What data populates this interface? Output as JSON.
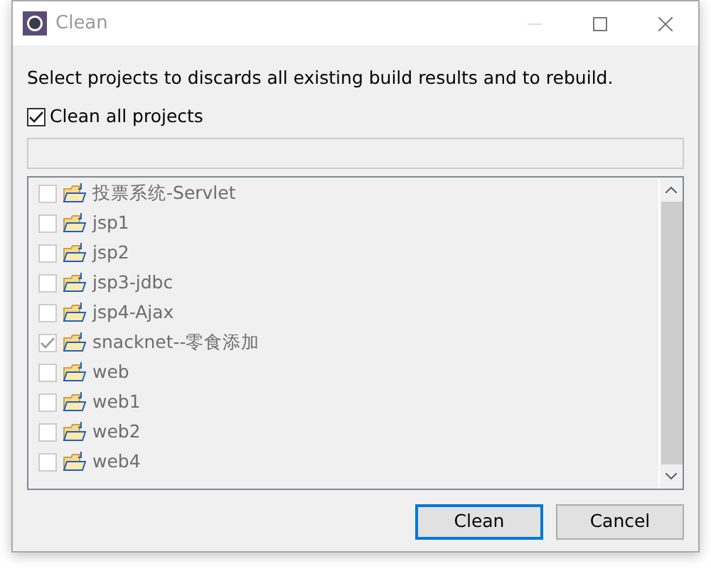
{
  "window": {
    "title": "Clean"
  },
  "message": "Select projects to discards all existing build results and to rebuild.",
  "clean_all": {
    "label": "Clean all projects",
    "checked": true
  },
  "projects": {
    "disabled": true,
    "items": [
      {
        "name": "投票系统-Servlet",
        "checked": false
      },
      {
        "name": "jsp1",
        "checked": false
      },
      {
        "name": "jsp2",
        "checked": false
      },
      {
        "name": "jsp3-jdbc",
        "checked": false
      },
      {
        "name": "jsp4-Ajax",
        "checked": false
      },
      {
        "name": "snacknet--零食添加",
        "checked": true
      },
      {
        "name": "web",
        "checked": false
      },
      {
        "name": "web1",
        "checked": false
      },
      {
        "name": "web2",
        "checked": false
      },
      {
        "name": "web4",
        "checked": false
      }
    ]
  },
  "buttons": [
    {
      "label": "Clean",
      "default": true
    },
    {
      "label": "Cancel",
      "default": false
    }
  ]
}
